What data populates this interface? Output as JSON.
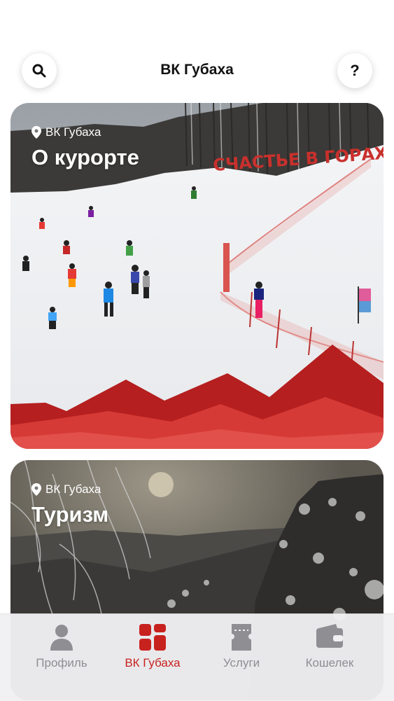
{
  "header": {
    "title": "ВК Губаха",
    "search_icon": "search-icon",
    "help_label": "?"
  },
  "cards": [
    {
      "location": "ВК Губаха",
      "title": "О курорте",
      "banner_text": "СЧАСТЬЕ В ГОРАХ"
    },
    {
      "location": "ВК Губаха",
      "title": "Туризм"
    }
  ],
  "tabbar": {
    "items": [
      {
        "label": "Профиль",
        "icon": "person-icon",
        "active": false
      },
      {
        "label": "ВК Губаха",
        "icon": "grid-icon",
        "active": true
      },
      {
        "label": "Услуги",
        "icon": "ticket-icon",
        "active": false
      },
      {
        "label": "Кошелек",
        "icon": "wallet-icon",
        "active": false
      }
    ]
  },
  "colors": {
    "accent": "#c8221f",
    "inactive": "#8e8e93"
  }
}
